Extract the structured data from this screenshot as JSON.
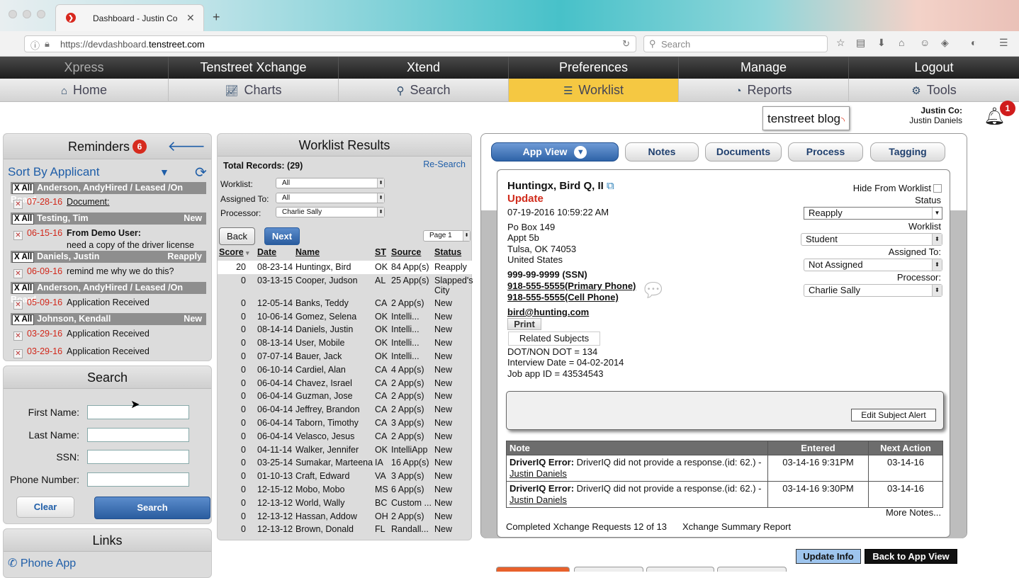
{
  "browser": {
    "tab_title": "Dashboard - Justin Co",
    "url_prefix": "https://devdashboard.",
    "url_domain": "tenstreet.com",
    "search_placeholder": "Search"
  },
  "nav_top": [
    "Xpress",
    "Tenstreet Xchange",
    "Xtend",
    "Preferences",
    "Manage",
    "Logout"
  ],
  "nav_main": [
    {
      "label": "Home",
      "icon": "home-icon"
    },
    {
      "label": "Charts",
      "icon": "chart-icon"
    },
    {
      "label": "Search",
      "icon": "search-icon"
    },
    {
      "label": "Worklist",
      "icon": "list-icon"
    },
    {
      "label": "Reports",
      "icon": "dashboard-icon"
    },
    {
      "label": "Tools",
      "icon": "gears-icon"
    }
  ],
  "header": {
    "blog": "tenstreet blog",
    "company": "Justin Co:",
    "user": "Justin Daniels",
    "notifications": "1"
  },
  "reminders": {
    "title": "Reminders",
    "count": "6",
    "sort_label": "Sort By Applicant",
    "groups": [
      {
        "xall": "X All",
        "name": "Anderson, AndyHired / Leased /On Board",
        "tag": "",
        "items": [
          {
            "date": "07-28-16",
            "text": "Document:"
          }
        ]
      },
      {
        "xall": "X All",
        "name": "Testing, Tim",
        "tag": "New",
        "items": [
          {
            "date": "06-15-16",
            "text": "From Demo User:",
            "text2": "need a copy of the driver license"
          }
        ]
      },
      {
        "xall": "X All",
        "name": "Daniels, Justin",
        "tag": "Reapply",
        "items": [
          {
            "date": "06-09-16",
            "text": "remind me why we do this?"
          }
        ]
      },
      {
        "xall": "X All",
        "name": "Anderson, AndyHired / Leased /On Board",
        "tag": "",
        "items": [
          {
            "date": "05-09-16",
            "text": "Application Received"
          }
        ]
      },
      {
        "xall": "X All",
        "name": "Johnson, Kendall",
        "tag": "New",
        "items": [
          {
            "date": "03-29-16",
            "text": "Application Received"
          },
          {
            "date": "03-29-16",
            "text": "Application Received"
          }
        ]
      }
    ]
  },
  "search": {
    "title": "Search",
    "first_name": "First Name:",
    "last_name": "Last Name:",
    "ssn": "SSN:",
    "phone": "Phone Number:",
    "clear": "Clear",
    "search": "Search"
  },
  "links": {
    "title": "Links",
    "phone_app": "Phone App"
  },
  "worklist": {
    "title": "Worklist Results",
    "total": "Total Records: (29)",
    "research": "Re-Search",
    "filters": [
      {
        "label": "Worklist:",
        "value": "All"
      },
      {
        "label": "Assigned To:",
        "value": "All"
      },
      {
        "label": "Processor:",
        "value": "Charlie Sally"
      }
    ],
    "back": "Back",
    "next": "Next",
    "page": "Page 1",
    "columns": [
      "Score",
      "Date",
      "Name",
      "ST",
      "Source",
      "Status"
    ],
    "rows": [
      [
        "20",
        "08-23-14",
        "Huntingx, Bird",
        "OK",
        "84 App(s)",
        "Reapply"
      ],
      [
        "0",
        "03-13-15",
        "Cooper, Judson",
        "AL",
        "25 App(s)",
        "Slapped's",
        "City"
      ],
      [
        "0",
        "12-05-14",
        "Banks, Teddy",
        "CA",
        "2 App(s)",
        "New"
      ],
      [
        "0",
        "10-06-14",
        "Gomez, Selena",
        "OK",
        "Intelli...",
        "New"
      ],
      [
        "0",
        "08-14-14",
        "Daniels, Justin",
        "OK",
        "Intelli...",
        "New"
      ],
      [
        "0",
        "08-13-14",
        "User, Mobile",
        "OK",
        "Intelli...",
        "New"
      ],
      [
        "0",
        "07-07-14",
        "Bauer, Jack",
        "OK",
        "Intelli...",
        "New"
      ],
      [
        "0",
        "06-10-14",
        "Cardiel, Alan",
        "CA",
        "4 App(s)",
        "New"
      ],
      [
        "0",
        "06-04-14",
        "Chavez, Israel",
        "CA",
        "2 App(s)",
        "New"
      ],
      [
        "0",
        "06-04-14",
        "Guzman, Jose",
        "CA",
        "2 App(s)",
        "New"
      ],
      [
        "0",
        "06-04-14",
        "Jeffrey, Brandon",
        "CA",
        "2 App(s)",
        "New"
      ],
      [
        "0",
        "06-04-14",
        "Taborn, Timothy",
        "CA",
        "3 App(s)",
        "New"
      ],
      [
        "0",
        "06-04-14",
        "Velasco, Jesus",
        "CA",
        "2 App(s)",
        "New"
      ],
      [
        "0",
        "04-11-14",
        "Walker, Jennifer",
        "OK",
        "IntelliApp",
        "New"
      ],
      [
        "0",
        "03-25-14",
        "Sumakar, Marteena",
        "IA",
        "16 App(s)",
        "New"
      ],
      [
        "0",
        "01-10-13",
        "Craft, Edward",
        "VA",
        "3 App(s)",
        "New"
      ],
      [
        "0",
        "12-15-12",
        "Mobo, Mobo",
        "MS",
        "6 App(s)",
        "New"
      ],
      [
        "0",
        "12-13-12",
        "World, Wally",
        "BC",
        "Custom ...",
        "New"
      ],
      [
        "0",
        "12-13-12",
        "Hassan, Addow",
        "OH",
        "2 App(s)",
        "New"
      ],
      [
        "0",
        "12-13-12",
        "Brown, Donald",
        "FL",
        "Randall...",
        "New"
      ]
    ]
  },
  "app": {
    "tabs": [
      "App View",
      "Notes",
      "Documents",
      "Process",
      "Tagging"
    ],
    "name": "Huntingx, Bird Q, II",
    "update": "Update",
    "datetime": "07-19-2016 10:59:22 AM",
    "address": [
      "Po Box 149",
      "Appt 5b",
      "Tulsa, OK 74053",
      "United States"
    ],
    "ssn": "999-99-9999 (SSN)",
    "phone1": "918-555-5555(Primary Phone)",
    "phone2": "918-555-5555(Cell Phone)",
    "email": "bird@hunting.com",
    "print": "Print",
    "related": "Related Subjects",
    "details": [
      "DOT/NON DOT = 134",
      "Interview Date = 04-02-2014",
      "Job app ID = 43534543"
    ],
    "hide": "Hide From Worklist",
    "status_label": "Status",
    "status": "Reapply",
    "worklist_label": "Worklist",
    "worklist": "Student",
    "assigned_label": "Assigned To:",
    "assigned": "Not Assigned",
    "processor_label": "Processor:",
    "processor": "Charlie Sally",
    "edit_alert": "Edit Subject Alert",
    "note_cols": [
      "Note",
      "Entered",
      "Next Action"
    ],
    "notes": [
      {
        "bold": "DriverIQ Error:",
        "text": " DriverIQ did not provide a response.(id: 62.) -",
        "author": "Justin Daniels",
        "entered": "03-14-16 9:31PM",
        "next": "03-14-16"
      },
      {
        "bold": "DriverIQ Error:",
        "text": " DriverIQ did not provide a response.(id: 62.) -",
        "author": "Justin Daniels",
        "entered": "03-14-16 9:30PM",
        "next": "03-14-16"
      }
    ],
    "more_notes": "More Notes...",
    "xchange_count": "Completed Xchange Requests 12 of 13",
    "xchange_report": "Xchange Summary Report",
    "update_info": "Update Info",
    "back_app_view": "Back to App View"
  }
}
